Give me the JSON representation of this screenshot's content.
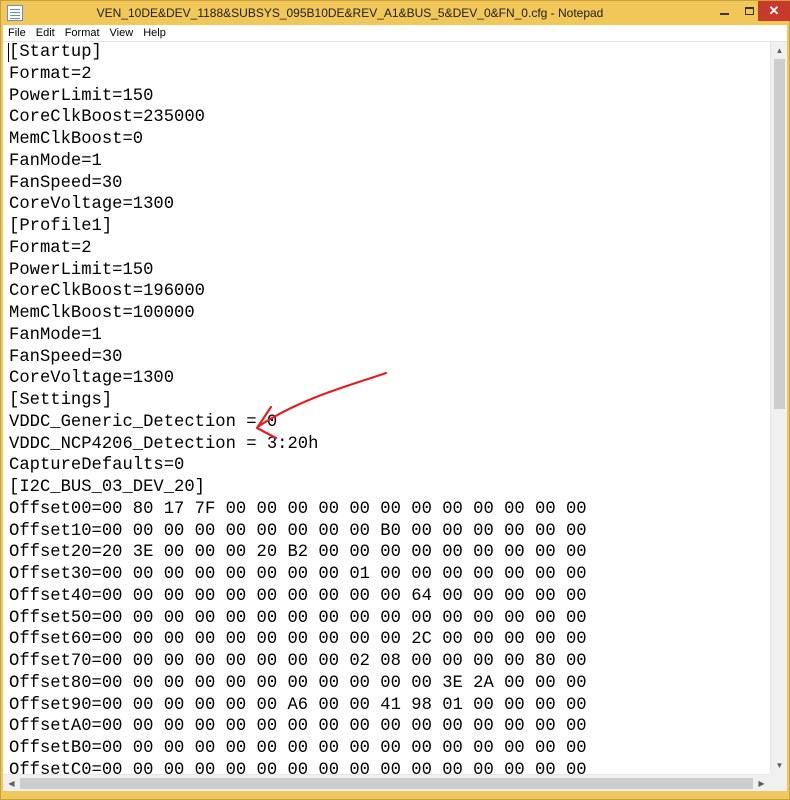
{
  "window": {
    "title": "VEN_10DE&DEV_1188&SUBSYS_095B10DE&REV_A1&BUS_5&DEV_0&FN_0.cfg - Notepad",
    "controls": {
      "minimize": "",
      "maximize": "",
      "close": "✕"
    }
  },
  "menu": {
    "items": [
      "File",
      "Edit",
      "Format",
      "View",
      "Help"
    ]
  },
  "document": {
    "lines": [
      "[Startup]",
      "Format=2",
      "PowerLimit=150",
      "CoreClkBoost=235000",
      "MemClkBoost=0",
      "FanMode=1",
      "FanSpeed=30",
      "CoreVoltage=1300",
      "[Profile1]",
      "Format=2",
      "PowerLimit=150",
      "CoreClkBoost=196000",
      "MemClkBoost=100000",
      "FanMode=1",
      "FanSpeed=30",
      "CoreVoltage=1300",
      "[Settings]",
      "VDDC_Generic_Detection = 0",
      "VDDC_NCP4206_Detection = 3:20h",
      "CaptureDefaults=0",
      "[I2C_BUS_03_DEV_20]",
      "Offset00=00 80 17 7F 00 00 00 00 00 00 00 00 00 00 00 00",
      "Offset10=00 00 00 00 00 00 00 00 00 B0 00 00 00 00 00 00",
      "Offset20=20 3E 00 00 00 20 B2 00 00 00 00 00 00 00 00 00",
      "Offset30=00 00 00 00 00 00 00 00 01 00 00 00 00 00 00 00",
      "Offset40=00 00 00 00 00 00 00 00 00 00 64 00 00 00 00 00",
      "Offset50=00 00 00 00 00 00 00 00 00 00 00 00 00 00 00 00",
      "Offset60=00 00 00 00 00 00 00 00 00 00 2C 00 00 00 00 00",
      "Offset70=00 00 00 00 00 00 00 00 02 08 00 00 00 00 80 00",
      "Offset80=00 00 00 00 00 00 00 00 00 00 00 3E 2A 00 00 00",
      "Offset90=00 00 00 00 00 00 A6 00 00 41 98 01 00 00 00 00",
      "OffsetA0=00 00 00 00 00 00 00 00 00 00 00 00 00 00 00 00",
      "OffsetB0=00 00 00 00 00 00 00 00 00 00 00 00 00 00 00 00",
      "OffsetC0=00 00 00 00 00 00 00 00 00 00 00 00 00 00 00 00"
    ]
  },
  "colors": {
    "frame": "#f0c95e",
    "annotation": "#e02020"
  },
  "icons": {
    "app": "notepad-icon",
    "annotation": "red-arrow-icon"
  }
}
